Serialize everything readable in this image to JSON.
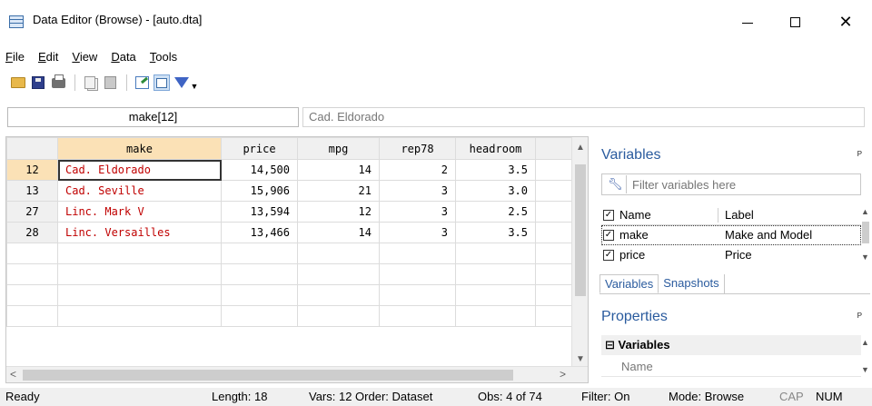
{
  "window": {
    "title": "Data Editor (Browse) - [auto.dta]",
    "minimize_glyph": "—",
    "close_glyph": "✕"
  },
  "menu": [
    "File",
    "Edit",
    "View",
    "Data",
    "Tools"
  ],
  "toolbar": {
    "icons": [
      "open-icon",
      "save-icon",
      "print-icon",
      "copy-icon",
      "paste-icon",
      "edit-mode-icon",
      "browse-mode-icon",
      "filter-icon"
    ],
    "dropdown_glyph": "▼"
  },
  "cellbar": {
    "cell_name": "make[12]",
    "cell_value": "Cad. Eldorado"
  },
  "grid": {
    "columns": [
      "make",
      "price",
      "mpg",
      "rep78",
      "headroom"
    ],
    "rows": [
      {
        "obs": "12",
        "make": "Cad. Eldorado",
        "price": "14,500",
        "mpg": "14",
        "rep78": "2",
        "headroom": "3.5"
      },
      {
        "obs": "13",
        "make": "Cad. Seville",
        "price": "15,906",
        "mpg": "21",
        "rep78": "3",
        "headroom": "3.0"
      },
      {
        "obs": "27",
        "make": "Linc. Mark V",
        "price": "13,594",
        "mpg": "12",
        "rep78": "3",
        "headroom": "2.5"
      },
      {
        "obs": "28",
        "make": "Linc. Versailles",
        "price": "13,466",
        "mpg": "14",
        "rep78": "3",
        "headroom": "3.5"
      }
    ],
    "scroll_up": "▲",
    "scroll_down": "▼",
    "scroll_left": "<",
    "scroll_right": ">"
  },
  "variables_panel": {
    "title": "Variables",
    "pin_glyph": "ᵖ",
    "filter_placeholder": "Filter variables here",
    "header": {
      "name": "Name",
      "label": "Label"
    },
    "rows": [
      {
        "name": "make",
        "label": "Make and Model",
        "checked": true
      },
      {
        "name": "price",
        "label": "Price",
        "checked": true
      }
    ],
    "tabs": [
      "Variables",
      "Snapshots"
    ],
    "check_glyph": "✓"
  },
  "properties_panel": {
    "title": "Properties",
    "group": "Variables",
    "group_toggle": "⊟",
    "field_name": "Name"
  },
  "status": {
    "ready": "Ready",
    "length": "Length: 18",
    "vars": "Vars: 12  Order: Dataset",
    "obs": "Obs: 4 of 74",
    "filter": "Filter: On",
    "mode": "Mode: Browse",
    "cap": "CAP",
    "num": "NUM"
  }
}
